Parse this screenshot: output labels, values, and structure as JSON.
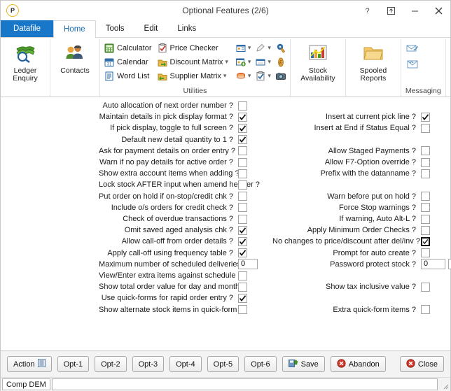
{
  "window": {
    "title": "Optional Features (2/6)",
    "logo_letter": "P",
    "controls": [
      {
        "name": "help",
        "glyph": "?"
      },
      {
        "name": "restore-up",
        "glyph": "⤒"
      },
      {
        "name": "minimize",
        "glyph": "–"
      },
      {
        "name": "close",
        "glyph": "✕"
      }
    ]
  },
  "tabs": [
    {
      "label": "Datafile",
      "kind": "file"
    },
    {
      "label": "Home",
      "kind": "active"
    },
    {
      "label": "Tools",
      "kind": "normal"
    },
    {
      "label": "Edit",
      "kind": "normal"
    },
    {
      "label": "Links",
      "kind": "normal"
    }
  ],
  "ribbon": {
    "ledger_enquiry": {
      "line1": "Ledger",
      "line2": "Enquiry",
      "icon": "ledger-enquiry-icon"
    },
    "contacts": {
      "label": "Contacts",
      "icon": "contacts-icon"
    },
    "utilities": {
      "group_title": "Utilities",
      "col1": [
        {
          "label": "Calculator",
          "icon": "calculator-icon"
        },
        {
          "label": "Calendar",
          "icon": "calendar-icon"
        },
        {
          "label": "Word List",
          "icon": "word-list-icon"
        }
      ],
      "col2": [
        {
          "label": "Price Checker",
          "icon": "price-checker-icon",
          "dropdown": false
        },
        {
          "label": "Discount Matrix",
          "icon": "discount-matrix-icon",
          "dropdown": true
        },
        {
          "label": "Supplier Matrix",
          "icon": "supplier-matrix-icon",
          "dropdown": true
        }
      ],
      "col3": [
        {
          "icon": "contact-card-icon",
          "dropdown": true
        },
        {
          "icon": "add-contact-icon",
          "dropdown": true
        },
        {
          "icon": "books-icon",
          "dropdown": true
        }
      ],
      "col4": [
        {
          "icon": "notes-icon",
          "dropdown": true
        },
        {
          "icon": "window-icon",
          "dropdown": true
        },
        {
          "icon": "checklist-icon",
          "dropdown": true
        }
      ],
      "col5": [
        {
          "icon": "paint-icon"
        },
        {
          "icon": "currency-icon"
        },
        {
          "icon": "camera-icon"
        }
      ]
    },
    "stock_availability": {
      "line1": "Stock",
      "line2": "Availability",
      "icon": "stock-chart-icon"
    },
    "spooled_reports": {
      "line1": "Spooled",
      "line2": "Reports",
      "icon": "folder-icon"
    },
    "messaging": {
      "group_title": "Messaging",
      "icons": [
        "send-mail-icon",
        "receive-mail-icon"
      ]
    }
  },
  "left_column": [
    {
      "label": "Auto allocation of next order number ?",
      "checked": false
    },
    {
      "label": "Maintain details in pick display format ?",
      "checked": true
    },
    {
      "label": "If pick display, toggle to full screen ?",
      "checked": true
    },
    {
      "label": "Default new detail quantity to 1 ?",
      "checked": true
    },
    {
      "label": "Ask for payment details on order entry ?",
      "checked": false
    },
    {
      "label": "Warn if no pay details for active order ?",
      "checked": false
    },
    {
      "label": "Show extra account items when adding ?",
      "checked": false
    },
    {
      "label": "Lock stock AFTER input when amend header ?",
      "checked": false
    },
    {
      "label": "Put order on hold if on-stop/credit chk ?",
      "checked": false
    },
    {
      "label": "Include o/s orders for credit check ?",
      "checked": false
    },
    {
      "label": "Check of overdue transactions ?",
      "checked": false
    },
    {
      "label": "Omit saved aged analysis chk ?",
      "checked": true
    },
    {
      "label": "Allow call-off from order details ?",
      "checked": true
    },
    {
      "label": "Apply call-off using frequency table ?",
      "checked": true
    },
    {
      "label": "Maximum number of scheduled deliveries ?",
      "type": "text",
      "value": "0"
    },
    {
      "label": "View/Enter extra items against schedule ?",
      "checked": false
    },
    {
      "label": "Show total order value for day and month ?",
      "checked": false
    },
    {
      "label": "Use quick-forms for rapid order entry ?",
      "checked": true
    },
    {
      "label": "Show alternate stock items in quick-form ?",
      "checked": false
    }
  ],
  "right_column": [
    {
      "label": "Insert at current pick line ?",
      "checked": true,
      "row": 1
    },
    {
      "label": "Insert at End if Status Equal ?",
      "checked": false,
      "row": 2
    },
    {
      "label": "Allow Staged Payments ?",
      "checked": false,
      "row": 4
    },
    {
      "label": "Allow F7-Option override ?",
      "checked": false,
      "row": 5
    },
    {
      "label": "Prefix with the datanname ?",
      "checked": false,
      "row": 6
    },
    {
      "label": "Warn before put on hold ?",
      "checked": false,
      "row": 8
    },
    {
      "label": "Force Stop warnings ?",
      "checked": false,
      "row": 9
    },
    {
      "label": "If warning, Auto Alt-L ?",
      "checked": false,
      "row": 10
    },
    {
      "label": "Apply Minimum Order Checks ?",
      "checked": false,
      "row": 11
    },
    {
      "label": "No changes to price/discount after del/inv ?",
      "checked": true,
      "focused": true,
      "row": 12
    },
    {
      "label": "Prompt for auto create ?",
      "checked": false,
      "row": 13
    },
    {
      "label": "Password protect stock ?",
      "type": "text2",
      "value": "0",
      "value2": "",
      "row": 14
    },
    {
      "label": "Show tax inclusive value ?",
      "checked": false,
      "row": 16
    },
    {
      "label": "Extra quick-form items ?",
      "checked": false,
      "row": 18
    }
  ],
  "buttons": [
    {
      "label": "Action",
      "name": "action-button",
      "icon": "list-icon"
    },
    {
      "label": "Opt-1",
      "name": "opt1-button",
      "underline": "O"
    },
    {
      "label": "Opt-2",
      "name": "opt2-button",
      "underline": "O"
    },
    {
      "label": "Opt-3",
      "name": "opt3-button",
      "underline": "O"
    },
    {
      "label": "Opt-4",
      "name": "opt4-button",
      "underline": "O"
    },
    {
      "label": "Opt-5",
      "name": "opt5-button",
      "underline": "O"
    },
    {
      "label": "Opt-6",
      "name": "opt6-button",
      "underline": "O"
    },
    {
      "label": "Save",
      "name": "save-button",
      "icon": "save-icon",
      "underline": "S"
    },
    {
      "label": "Abandon",
      "name": "abandon-button",
      "icon": "abandon-icon",
      "underline": "A"
    }
  ],
  "close_button": {
    "label": "Close",
    "icon": "close-circle-icon"
  },
  "statusbar": {
    "company": "Comp DEM",
    "message": ""
  }
}
